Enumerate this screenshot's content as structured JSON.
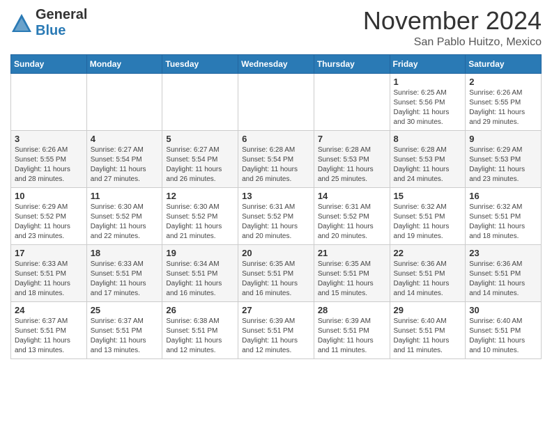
{
  "header": {
    "logo_general": "General",
    "logo_blue": "Blue",
    "month": "November 2024",
    "location": "San Pablo Huitzo, Mexico"
  },
  "weekdays": [
    "Sunday",
    "Monday",
    "Tuesday",
    "Wednesday",
    "Thursday",
    "Friday",
    "Saturday"
  ],
  "weeks": [
    [
      {
        "day": "",
        "info": ""
      },
      {
        "day": "",
        "info": ""
      },
      {
        "day": "",
        "info": ""
      },
      {
        "day": "",
        "info": ""
      },
      {
        "day": "",
        "info": ""
      },
      {
        "day": "1",
        "info": "Sunrise: 6:25 AM\nSunset: 5:56 PM\nDaylight: 11 hours\nand 30 minutes."
      },
      {
        "day": "2",
        "info": "Sunrise: 6:26 AM\nSunset: 5:55 PM\nDaylight: 11 hours\nand 29 minutes."
      }
    ],
    [
      {
        "day": "3",
        "info": "Sunrise: 6:26 AM\nSunset: 5:55 PM\nDaylight: 11 hours\nand 28 minutes."
      },
      {
        "day": "4",
        "info": "Sunrise: 6:27 AM\nSunset: 5:54 PM\nDaylight: 11 hours\nand 27 minutes."
      },
      {
        "day": "5",
        "info": "Sunrise: 6:27 AM\nSunset: 5:54 PM\nDaylight: 11 hours\nand 26 minutes."
      },
      {
        "day": "6",
        "info": "Sunrise: 6:28 AM\nSunset: 5:54 PM\nDaylight: 11 hours\nand 26 minutes."
      },
      {
        "day": "7",
        "info": "Sunrise: 6:28 AM\nSunset: 5:53 PM\nDaylight: 11 hours\nand 25 minutes."
      },
      {
        "day": "8",
        "info": "Sunrise: 6:28 AM\nSunset: 5:53 PM\nDaylight: 11 hours\nand 24 minutes."
      },
      {
        "day": "9",
        "info": "Sunrise: 6:29 AM\nSunset: 5:53 PM\nDaylight: 11 hours\nand 23 minutes."
      }
    ],
    [
      {
        "day": "10",
        "info": "Sunrise: 6:29 AM\nSunset: 5:52 PM\nDaylight: 11 hours\nand 23 minutes."
      },
      {
        "day": "11",
        "info": "Sunrise: 6:30 AM\nSunset: 5:52 PM\nDaylight: 11 hours\nand 22 minutes."
      },
      {
        "day": "12",
        "info": "Sunrise: 6:30 AM\nSunset: 5:52 PM\nDaylight: 11 hours\nand 21 minutes."
      },
      {
        "day": "13",
        "info": "Sunrise: 6:31 AM\nSunset: 5:52 PM\nDaylight: 11 hours\nand 20 minutes."
      },
      {
        "day": "14",
        "info": "Sunrise: 6:31 AM\nSunset: 5:52 PM\nDaylight: 11 hours\nand 20 minutes."
      },
      {
        "day": "15",
        "info": "Sunrise: 6:32 AM\nSunset: 5:51 PM\nDaylight: 11 hours\nand 19 minutes."
      },
      {
        "day": "16",
        "info": "Sunrise: 6:32 AM\nSunset: 5:51 PM\nDaylight: 11 hours\nand 18 minutes."
      }
    ],
    [
      {
        "day": "17",
        "info": "Sunrise: 6:33 AM\nSunset: 5:51 PM\nDaylight: 11 hours\nand 18 minutes."
      },
      {
        "day": "18",
        "info": "Sunrise: 6:33 AM\nSunset: 5:51 PM\nDaylight: 11 hours\nand 17 minutes."
      },
      {
        "day": "19",
        "info": "Sunrise: 6:34 AM\nSunset: 5:51 PM\nDaylight: 11 hours\nand 16 minutes."
      },
      {
        "day": "20",
        "info": "Sunrise: 6:35 AM\nSunset: 5:51 PM\nDaylight: 11 hours\nand 16 minutes."
      },
      {
        "day": "21",
        "info": "Sunrise: 6:35 AM\nSunset: 5:51 PM\nDaylight: 11 hours\nand 15 minutes."
      },
      {
        "day": "22",
        "info": "Sunrise: 6:36 AM\nSunset: 5:51 PM\nDaylight: 11 hours\nand 14 minutes."
      },
      {
        "day": "23",
        "info": "Sunrise: 6:36 AM\nSunset: 5:51 PM\nDaylight: 11 hours\nand 14 minutes."
      }
    ],
    [
      {
        "day": "24",
        "info": "Sunrise: 6:37 AM\nSunset: 5:51 PM\nDaylight: 11 hours\nand 13 minutes."
      },
      {
        "day": "25",
        "info": "Sunrise: 6:37 AM\nSunset: 5:51 PM\nDaylight: 11 hours\nand 13 minutes."
      },
      {
        "day": "26",
        "info": "Sunrise: 6:38 AM\nSunset: 5:51 PM\nDaylight: 11 hours\nand 12 minutes."
      },
      {
        "day": "27",
        "info": "Sunrise: 6:39 AM\nSunset: 5:51 PM\nDaylight: 11 hours\nand 12 minutes."
      },
      {
        "day": "28",
        "info": "Sunrise: 6:39 AM\nSunset: 5:51 PM\nDaylight: 11 hours\nand 11 minutes."
      },
      {
        "day": "29",
        "info": "Sunrise: 6:40 AM\nSunset: 5:51 PM\nDaylight: 11 hours\nand 11 minutes."
      },
      {
        "day": "30",
        "info": "Sunrise: 6:40 AM\nSunset: 5:51 PM\nDaylight: 11 hours\nand 10 minutes."
      }
    ]
  ]
}
